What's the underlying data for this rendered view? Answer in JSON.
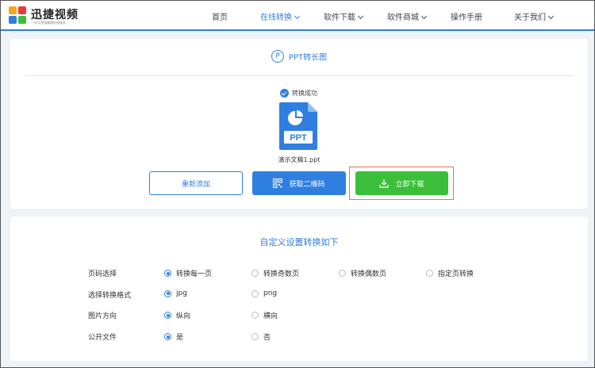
{
  "header": {
    "brand_name": "迅捷视频",
    "brand_slogan": "一站式视频编辑处理服务",
    "nav": [
      {
        "label": "首页",
        "active": false,
        "dropdown": false
      },
      {
        "label": "在线转换",
        "active": true,
        "dropdown": true
      },
      {
        "label": "软件下载",
        "active": false,
        "dropdown": true
      },
      {
        "label": "软件商城",
        "active": false,
        "dropdown": true
      },
      {
        "label": "操作手册",
        "active": false,
        "dropdown": false
      },
      {
        "label": "关于我们",
        "active": false,
        "dropdown": true
      }
    ]
  },
  "result": {
    "title_badge": "P",
    "title": "PPT转长图",
    "status": "转换成功",
    "file_type_label": "PPT",
    "filename": "演示文稿1.ppt",
    "buttons": {
      "readd": "重新添加",
      "qrcode": "获取二维码",
      "download": "立即下载"
    }
  },
  "settings": {
    "title": "自定义设置转换如下",
    "rows": [
      {
        "label": "页码选择",
        "options": [
          "转换每一页",
          "转换奇数页",
          "转换偶数页",
          "指定页转换"
        ],
        "selected": 0
      },
      {
        "label": "选择转换格式",
        "options": [
          "jpg",
          "png"
        ],
        "selected": 0
      },
      {
        "label": "图片方向",
        "options": [
          "纵向",
          "横向"
        ],
        "selected": 0
      },
      {
        "label": "公开文件",
        "options": [
          "是",
          "否"
        ],
        "selected": 0
      }
    ]
  },
  "colors": {
    "primary": "#2f7fe0",
    "success": "#3bbf3b",
    "highlight": "#e8744a"
  }
}
